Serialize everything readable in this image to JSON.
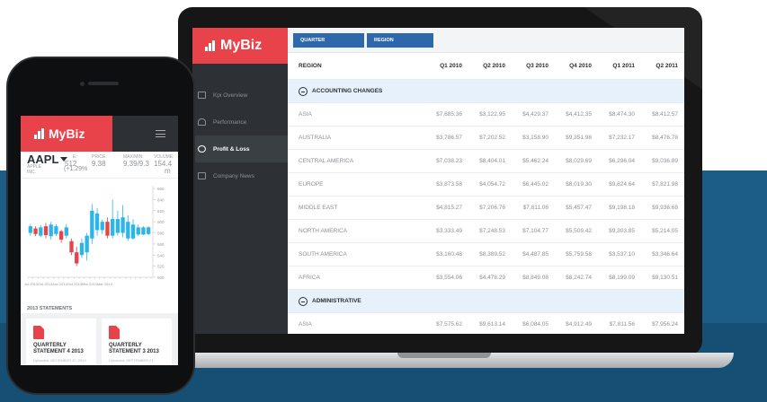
{
  "colors": {
    "brand_red": "#e8424b",
    "sidebar_dark": "#2d3135",
    "accent_blue": "#2f67ad",
    "section_bg": "#e7f1fb",
    "backdrop_blue": "#1b5d86"
  },
  "desktop": {
    "logo": "MyBiz",
    "nav": [
      {
        "label": "Kpi Overview",
        "icon": "monitor-icon"
      },
      {
        "label": "Performance",
        "icon": "users-icon"
      },
      {
        "label": "Profit & Loss",
        "icon": "dollar-icon",
        "active": true
      },
      {
        "label": "Company News",
        "icon": "newspaper-icon"
      }
    ],
    "buttons": {
      "quarter": "QUARTER",
      "region": "REGION"
    },
    "table": {
      "headers": [
        "REGION",
        "Q1 2010",
        "Q2 2010",
        "Q3 2010",
        "Q4 2010",
        "Q1 2011",
        "Q2 2011"
      ],
      "sections": [
        {
          "name": "ACCOUNTING CHANGES",
          "rows": [
            {
              "region": "ASIA",
              "values": [
                "$7,685.36",
                "$3,122.95",
                "$4,429.37",
                "$4,412.35",
                "$8,474.30",
                "$8,412.57"
              ]
            },
            {
              "region": "AUSTRALIA",
              "values": [
                "$3,786.57",
                "$7,202.52",
                "$3,158.90",
                "$9,351.98",
                "$7,232.17",
                "$8,476.78"
              ]
            },
            {
              "region": "CENTRAL AMERICA",
              "values": [
                "$7,038.23",
                "$8,404.01",
                "$5,462.24",
                "$8,029.69",
                "$6,296.04",
                "$9,036.89"
              ]
            },
            {
              "region": "EUROPE",
              "values": [
                "$3,873.58",
                "$4,054.72",
                "$6,445.02",
                "$8,019.30",
                "$9,824.64",
                "$7,821.98"
              ]
            },
            {
              "region": "MIDDLE EAST",
              "values": [
                "$4,815.27",
                "$7,206.76",
                "$7,811.06",
                "$5,457.47",
                "$9,198.18",
                "$9,936.68"
              ]
            },
            {
              "region": "NORTH AMERICA",
              "values": [
                "$3,333.49",
                "$7,248.53",
                "$7,104.77",
                "$5,509.42",
                "$9,303.85",
                "$5,214.05"
              ]
            },
            {
              "region": "SOUTH AMERICA",
              "values": [
                "$3,160.48",
                "$8,389.52",
                "$4,487.85",
                "$5,759.58",
                "$3,537.10",
                "$3,346.64"
              ]
            },
            {
              "region": "AFRICA",
              "values": [
                "$3,554.06",
                "$4,478.29",
                "$8,849.08",
                "$8,242.74",
                "$8,199.09",
                "$9,130.51"
              ]
            }
          ]
        },
        {
          "name": "ADMINISTRATIVE",
          "rows": [
            {
              "region": "ASIA",
              "values": [
                "$7,575.62",
                "$9,613.14",
                "$6,084.05",
                "$4,912.49",
                "$7,811.56",
                "$7,956.24"
              ]
            }
          ]
        }
      ]
    }
  },
  "mobile": {
    "logo": "MyBiz",
    "quote": {
      "ticker": "AAPL",
      "company_line1": "APPLE",
      "company_line2": "INC.",
      "change": "(+1.29%",
      "price_label": "E:",
      "price": "512",
      "price_label_2": "PRICE:",
      "price_value_2": "9.38",
      "max_min_label": "MAX/MIN:",
      "max_min_value": "9.39/9.3",
      "volume_label": "VOLUME:",
      "volume_value": "154.4",
      "volume_unit": "m"
    },
    "x_axis_text": "Jul 2013Oct 2013Jan 2014Oct 2013Mar 2014Mar 2014",
    "statements_title": "2013 STATEMENTS",
    "statements": [
      {
        "line1": "QUARTERLY",
        "line2": "STATEMENT 4 2013",
        "uploaded": "Uploaded: DECEMBER 22, 2013"
      },
      {
        "line1": "QUARTERLY",
        "line2": "STATEMENT 3 2013",
        "uploaded": "Uploaded: SEPTEMBER 21,"
      }
    ]
  },
  "chart_data": {
    "type": "candlestick",
    "y_ticks": [
      "660",
      "640",
      "620",
      "600",
      "580",
      "560",
      "540",
      "520",
      "500"
    ],
    "ylim": [
      500,
      665
    ],
    "candles": [
      {
        "o": 580,
        "c": 592,
        "h": 596,
        "l": 575,
        "up": true
      },
      {
        "o": 588,
        "c": 578,
        "h": 592,
        "l": 574,
        "up": false
      },
      {
        "o": 575,
        "c": 590,
        "h": 594,
        "l": 572,
        "up": true
      },
      {
        "o": 592,
        "c": 576,
        "h": 598,
        "l": 570,
        "up": false
      },
      {
        "o": 574,
        "c": 595,
        "h": 600,
        "l": 568,
        "up": true
      },
      {
        "o": 592,
        "c": 578,
        "h": 596,
        "l": 574,
        "up": true
      },
      {
        "o": 583,
        "c": 568,
        "h": 586,
        "l": 562,
        "up": false
      },
      {
        "o": 575,
        "c": 590,
        "h": 596,
        "l": 570,
        "up": true
      },
      {
        "o": 565,
        "c": 545,
        "h": 570,
        "l": 540,
        "up": false
      },
      {
        "o": 545,
        "c": 525,
        "h": 555,
        "l": 520,
        "up": false
      },
      {
        "o": 540,
        "c": 562,
        "h": 570,
        "l": 535,
        "up": true
      },
      {
        "o": 575,
        "c": 545,
        "h": 580,
        "l": 530,
        "up": true
      },
      {
        "o": 570,
        "c": 620,
        "h": 632,
        "l": 560,
        "up": true
      },
      {
        "o": 615,
        "c": 585,
        "h": 625,
        "l": 575,
        "up": true
      },
      {
        "o": 585,
        "c": 600,
        "h": 604,
        "l": 578,
        "up": true
      },
      {
        "o": 600,
        "c": 575,
        "h": 608,
        "l": 570,
        "up": false
      },
      {
        "o": 575,
        "c": 605,
        "h": 640,
        "l": 570,
        "up": true
      },
      {
        "o": 605,
        "c": 580,
        "h": 620,
        "l": 575,
        "up": true
      },
      {
        "o": 580,
        "c": 608,
        "h": 630,
        "l": 572,
        "up": true
      },
      {
        "o": 600,
        "c": 570,
        "h": 612,
        "l": 566,
        "up": true
      },
      {
        "o": 570,
        "c": 595,
        "h": 605,
        "l": 568,
        "up": true
      },
      {
        "o": 590,
        "c": 577,
        "h": 595,
        "l": 574,
        "up": true
      },
      {
        "o": 577,
        "c": 590,
        "h": 592,
        "l": 576,
        "up": true
      },
      {
        "o": 590,
        "c": 578,
        "h": 592,
        "l": 576,
        "up": true
      }
    ]
  }
}
